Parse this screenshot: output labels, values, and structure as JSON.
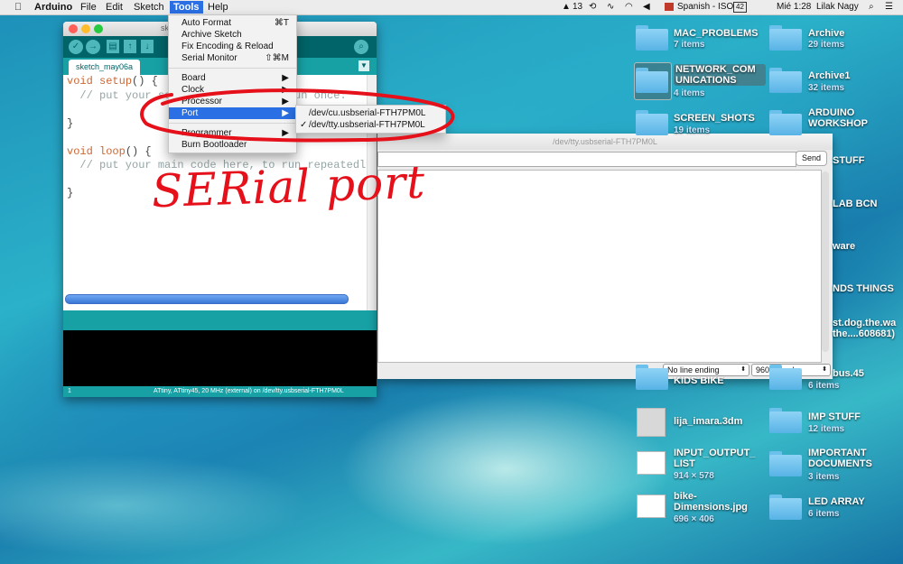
{
  "menubar": {
    "apple_icon": "apple-icon",
    "app_name": "Arduino",
    "menus": [
      "File",
      "Edit",
      "Sketch",
      "Tools",
      "Help"
    ],
    "status": {
      "adobe_count": "13",
      "input_source": "Spanish - ISO",
      "battery": "42",
      "clock": "Mié 1:28",
      "user": "Lilak Nagy"
    }
  },
  "tools_menu": {
    "items": [
      {
        "label": "Auto Format",
        "shortcut": "⌘T"
      },
      {
        "label": "Archive Sketch",
        "shortcut": ""
      },
      {
        "label": "Fix Encoding & Reload",
        "shortcut": ""
      },
      {
        "label": "Serial Monitor",
        "shortcut": "⇧⌘M"
      },
      {
        "label": "Board",
        "shortcut": "▶"
      },
      {
        "label": "Clock",
        "shortcut": "▶"
      },
      {
        "label": "Processor",
        "shortcut": "▶"
      },
      {
        "label": "Port",
        "shortcut": "▶"
      },
      {
        "label": "Programmer",
        "shortcut": "▶"
      },
      {
        "label": "Burn Bootloader",
        "shortcut": ""
      }
    ],
    "highlighted": "Port"
  },
  "port_menu": {
    "items": [
      "/dev/cu.usbserial-FTH7PM0L",
      "/dev/tty.usbserial-FTH7PM0L"
    ],
    "checked_index": 1,
    "check_mark": "✓"
  },
  "ide": {
    "title": "sketch_may06a",
    "tab_label": "sketch_may06a",
    "code": {
      "l1_kw": "void",
      "l1_fn": "setup",
      "l1_rest": "() {",
      "l2": "  // put your setup code here, to run once:",
      "l4": "}",
      "l6_kw": "void",
      "l6_fn": "loop",
      "l6_rest": "() {",
      "l7": "  // put your main code here, to run repeatedly:",
      "l9": "}"
    },
    "status_line": "1",
    "status_board": "ATtiny, ATtiny45, 20 MHz (external) on /dev/tty.usbserial-FTH7PM0L"
  },
  "serial_monitor": {
    "title": "/dev/tty.usbserial-FTH7PM0L",
    "input_value": "",
    "send_label": "Send",
    "line_ending": "No line ending",
    "baud": "9600 baud"
  },
  "annotation": {
    "text": "SERial port",
    "color": "#e5101a"
  },
  "desktop": {
    "col1": [
      {
        "name": "MAC_PROBLEMS",
        "sub": "7 items",
        "kind": "folder"
      },
      {
        "name": "NETWORK_COM UNICATIONS",
        "sub": "4 items",
        "kind": "folder",
        "selected": true
      },
      {
        "name": "SCREEN_SHOTS",
        "sub": "19 items",
        "kind": "folder"
      },
      {
        "name": "KIDS BIKE",
        "sub": "",
        "kind": "folder"
      },
      {
        "name": "lija_imara.3dm",
        "sub": "",
        "kind": "file"
      },
      {
        "name": "INPUT_OUTPUT_ LIST",
        "sub": "914 × 578",
        "kind": "image"
      },
      {
        "name": "bike- Dimensions.jpg",
        "sub": "696 × 406",
        "kind": "image"
      }
    ],
    "col2": [
      {
        "name": "Archive",
        "sub": "29 items",
        "kind": "folder"
      },
      {
        "name": "Archive1",
        "sub": "32 items",
        "kind": "folder"
      },
      {
        "name": "ARDUINO WORKSHOP",
        "sub": "",
        "kind": "folder"
      },
      {
        "name": "STUFF",
        "sub": "",
        "kind": "folder"
      },
      {
        "name": "LAB BCN",
        "sub": "",
        "kind": "folder"
      },
      {
        "name": "ware",
        "sub": "",
        "kind": "folder"
      },
      {
        "name": "NDS THINGS",
        "sub": "",
        "kind": "folder"
      },
      {
        "name": "st.dog.the.wa the....608681)",
        "sub": "",
        "kind": "folder"
      },
      {
        "name": "bus.45",
        "sub": "6 items",
        "kind": "folder"
      },
      {
        "name": "IMP STUFF",
        "sub": "12 items",
        "kind": "folder"
      },
      {
        "name": "IMPORTANT DOCUMENTS",
        "sub": "3 items",
        "kind": "folder"
      },
      {
        "name": "LED ARRAY",
        "sub": "6 items",
        "kind": "folder"
      }
    ]
  }
}
